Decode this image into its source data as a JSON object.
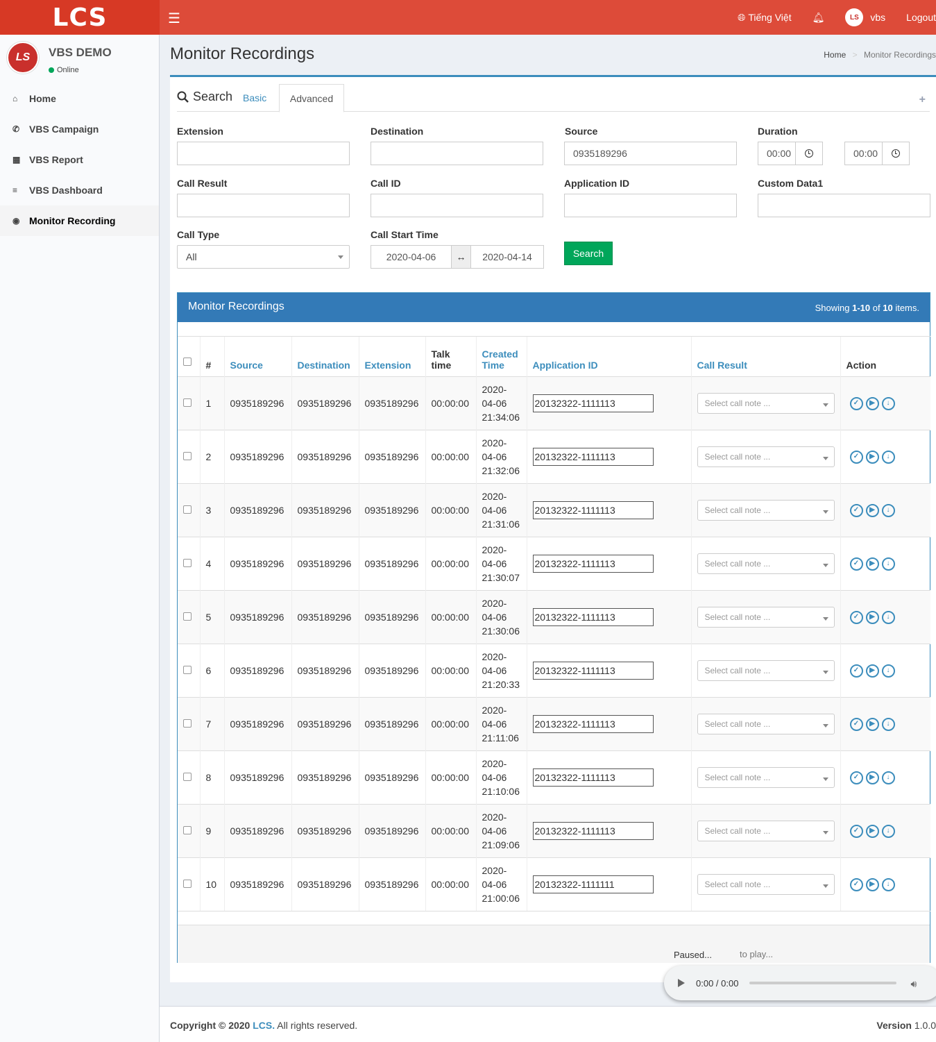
{
  "header": {
    "logo": "LCS",
    "language": "Tiếng Việt",
    "user": "vbs",
    "logout": "Logout"
  },
  "sidebar": {
    "user_name": "VBS DEMO",
    "status": "Online",
    "items": [
      {
        "label": "Home",
        "icon": "home-icon"
      },
      {
        "label": "VBS Campaign",
        "icon": "phone-volume-icon"
      },
      {
        "label": "VBS Report",
        "icon": "calculator-icon"
      },
      {
        "label": "VBS Dashboard",
        "icon": "database-icon"
      },
      {
        "label": "Monitor Recording",
        "icon": "play-circle-icon"
      }
    ]
  },
  "page": {
    "title": "Monitor Recordings",
    "breadcrumb_home": "Home",
    "breadcrumb_current": "Monitor Recordings"
  },
  "search": {
    "title": "Search",
    "tab_basic": "Basic",
    "tab_advanced": "Advanced",
    "extension_label": "Extension",
    "extension_value": "",
    "destination_label": "Destination",
    "destination_value": "",
    "source_label": "Source",
    "source_value": "0935189296",
    "duration_label": "Duration",
    "duration_from": "00:00",
    "duration_to": "00:00",
    "call_result_label": "Call Result",
    "call_id_label": "Call ID",
    "application_id_label": "Application ID",
    "custom_data_label": "Custom Data1",
    "call_type_label": "Call Type",
    "call_type_value": "All",
    "call_start_label": "Call Start Time",
    "start_date": "2020-04-06",
    "end_date": "2020-04-14",
    "search_button": "Search"
  },
  "grid": {
    "title": "Monitor Recordings",
    "showing_prefix": "Showing ",
    "showing_range": "1-10",
    "showing_of": " of ",
    "showing_total": "10",
    "showing_suffix": " items.",
    "columns": {
      "num": "#",
      "source": "Source",
      "destination": "Destination",
      "extension": "Extension",
      "talk_time": "Talk time",
      "created_time": "Created Time",
      "application_id": "Application ID",
      "call_result": "Call Result",
      "action": "Action"
    },
    "note_placeholder": "Select call note ...",
    "rows": [
      {
        "num": "1",
        "source": "0935189296",
        "destination": "0935189296",
        "extension": "0935189296",
        "talk": "00:00:00",
        "created": "2020-04-06 21:34:06",
        "app_id": "20132322-1111113"
      },
      {
        "num": "2",
        "source": "0935189296",
        "destination": "0935189296",
        "extension": "0935189296",
        "talk": "00:00:00",
        "created": "2020-04-06 21:32:06",
        "app_id": "20132322-1111113"
      },
      {
        "num": "3",
        "source": "0935189296",
        "destination": "0935189296",
        "extension": "0935189296",
        "talk": "00:00:00",
        "created": "2020-04-06 21:31:06",
        "app_id": "20132322-1111113"
      },
      {
        "num": "4",
        "source": "0935189296",
        "destination": "0935189296",
        "extension": "0935189296",
        "talk": "00:00:00",
        "created": "2020-04-06 21:30:07",
        "app_id": "20132322-1111113"
      },
      {
        "num": "5",
        "source": "0935189296",
        "destination": "0935189296",
        "extension": "0935189296",
        "talk": "00:00:00",
        "created": "2020-04-06 21:30:06",
        "app_id": "20132322-1111113"
      },
      {
        "num": "6",
        "source": "0935189296",
        "destination": "0935189296",
        "extension": "0935189296",
        "talk": "00:00:00",
        "created": "2020-04-06 21:20:33",
        "app_id": "20132322-1111113"
      },
      {
        "num": "7",
        "source": "0935189296",
        "destination": "0935189296",
        "extension": "0935189296",
        "talk": "00:00:00",
        "created": "2020-04-06 21:11:06",
        "app_id": "20132322-1111113"
      },
      {
        "num": "8",
        "source": "0935189296",
        "destination": "0935189296",
        "extension": "0935189296",
        "talk": "00:00:00",
        "created": "2020-04-06 21:10:06",
        "app_id": "20132322-1111113"
      },
      {
        "num": "9",
        "source": "0935189296",
        "destination": "0935189296",
        "extension": "0935189296",
        "talk": "00:00:00",
        "created": "2020-04-06 21:09:06",
        "app_id": "20132322-1111113"
      },
      {
        "num": "10",
        "source": "0935189296",
        "destination": "0935189296",
        "extension": "0935189296",
        "talk": "00:00:00",
        "created": "2020-04-06 21:00:06",
        "app_id": "20132322-1111111"
      }
    ],
    "paused": "Paused...",
    "to_play": "to play..."
  },
  "player": {
    "time": "0:00 / 0:00",
    "progress": 0
  },
  "footer": {
    "copyright_prefix": "Copyright © 2020",
    "brand": "LCS.",
    "rights": "All rights reserved.",
    "version_label": "Version",
    "version_value": "1.0.0"
  },
  "colors": {
    "header": "#dd4b39",
    "primary": "#3c8dbc",
    "panel_header": "#337ab7",
    "success": "#00a65a"
  }
}
